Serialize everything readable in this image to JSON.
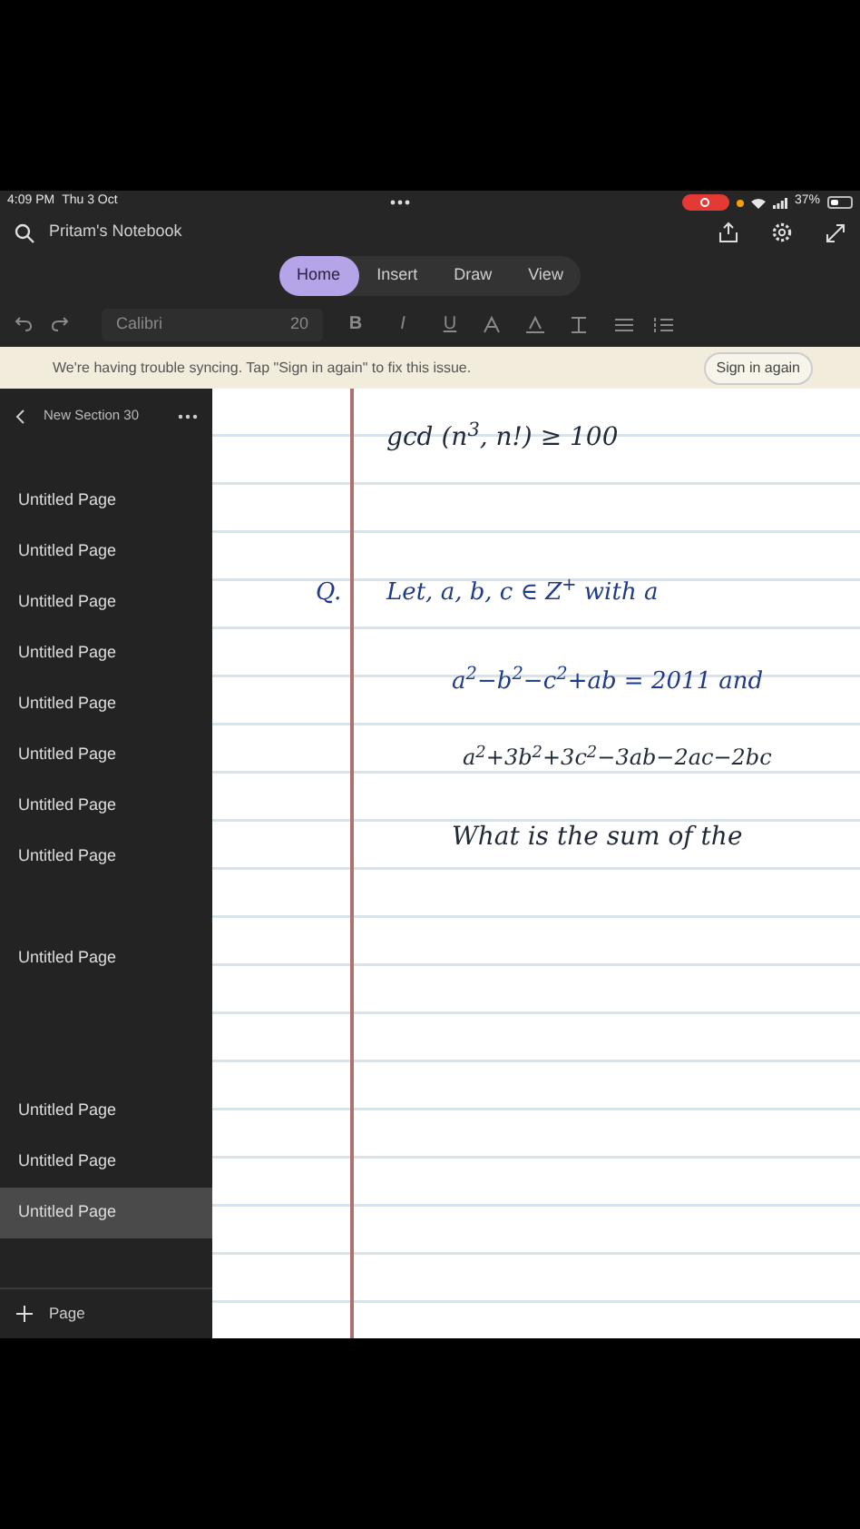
{
  "status_bar": {
    "time": "4:09 PM",
    "date": "Thu 3 Oct",
    "recording": true,
    "battery": "37%"
  },
  "title_bar": {
    "notebook": "Pritam's Notebook"
  },
  "tabs": [
    {
      "label": "Home",
      "selected": true
    },
    {
      "label": "Insert",
      "selected": false
    },
    {
      "label": "Draw",
      "selected": false
    },
    {
      "label": "View",
      "selected": false
    }
  ],
  "toolbar": {
    "font": "Calibri",
    "size": "20",
    "format_buttons": [
      "B",
      "I",
      "U"
    ],
    "disabled": true
  },
  "banner": {
    "message": "We're having trouble syncing. Tap \"Sign in again\" to fix this issue.",
    "button": "Sign in again"
  },
  "sidebar": {
    "section": "New Section 30",
    "groups": [
      [
        {
          "label": "Untitled Page",
          "selected": false
        },
        {
          "label": "Untitled Page",
          "selected": false
        },
        {
          "label": "Untitled Page",
          "selected": false
        },
        {
          "label": "Untitled Page",
          "selected": false
        },
        {
          "label": "Untitled Page",
          "selected": false
        },
        {
          "label": "Untitled Page",
          "selected": false
        },
        {
          "label": "Untitled Page",
          "selected": false
        },
        {
          "label": "Untitled Page",
          "selected": false
        }
      ],
      [
        {
          "label": "Untitled Page",
          "selected": false
        }
      ],
      [
        {
          "label": "Untitled Page",
          "selected": false
        },
        {
          "label": "Untitled Page",
          "selected": false
        },
        {
          "label": "Untitled Page",
          "selected": true
        }
      ]
    ],
    "add_page": "Page"
  },
  "note": {
    "ink": [
      {
        "text": "gcd (n$^{3}$, n!) ≥ 100",
        "color": "#1f2937"
      },
      {
        "text": "Q.",
        "color": "#1e3a8a"
      },
      {
        "text": "Let, a, b, c ∈ Z$^{+}$ with a",
        "color": "#1e3a8a"
      },
      {
        "text": "a$^{2}$−b$^{2}$−c$^{2}$+ab = 2011 and",
        "color": "#1e3a8a"
      },
      {
        "text": "a$^{2}$+3b$^{2}$+3c$^{2}$−3ab−2ac−2bc",
        "color": "#1f2937"
      },
      {
        "text": "What is the sum of the",
        "color": "#1f2937"
      }
    ]
  }
}
